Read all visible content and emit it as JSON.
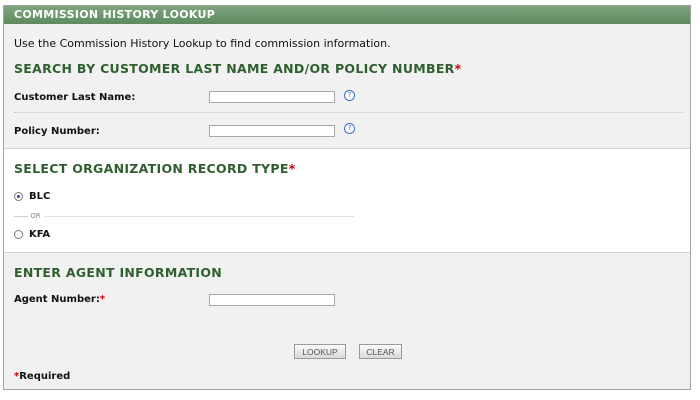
{
  "header": {
    "title": "COMMISSION HISTORY LOOKUP"
  },
  "intro": "Use the Commission History Lookup to find commission information.",
  "required_mark": "*",
  "search_section": {
    "title": "SEARCH BY CUSTOMER LAST NAME AND/OR POLICY NUMBER",
    "last_name_label": "Customer Last Name:",
    "last_name_value": "",
    "policy_label": "Policy Number:",
    "policy_value": "",
    "help_glyph": "?"
  },
  "org_section": {
    "title": "SELECT ORGANIZATION RECORD TYPE",
    "options": [
      {
        "label": "BLC",
        "checked": true
      },
      {
        "label": "KFA",
        "checked": false
      }
    ],
    "or_text": "OR"
  },
  "agent_section": {
    "title": "ENTER AGENT INFORMATION",
    "agent_label": "Agent Number:",
    "agent_value": ""
  },
  "buttons": {
    "lookup": "LOOKUP",
    "clear": "CLEAR"
  },
  "footer": {
    "required_text": "Required"
  },
  "icons": [
    "help-icon",
    "radio-selected-icon",
    "radio-unselected-icon"
  ],
  "colors": {
    "header": "#6b966b",
    "section_title": "#2f5f2f",
    "required": "#cc0000"
  }
}
